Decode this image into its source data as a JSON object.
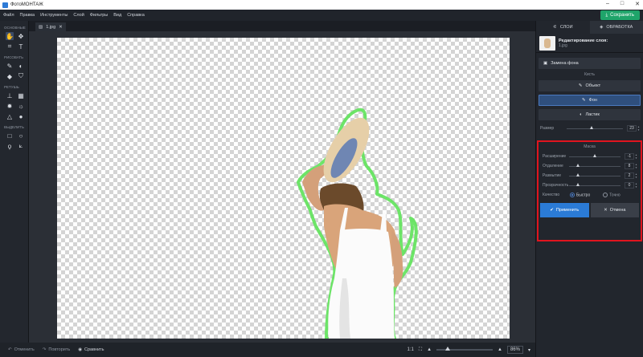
{
  "window": {
    "title": "ФотоМОНТАЖ"
  },
  "menu": [
    "Файл",
    "Правка",
    "Инструменты",
    "Слой",
    "Фильтры",
    "Вид",
    "Справка"
  ],
  "save_button": "Сохранить",
  "tools": {
    "groups": [
      {
        "title": "ОСНОВНЫЕ",
        "rows": [
          [
            "hand-tool-icon",
            "move-tool-icon"
          ],
          [
            "crop-tool-icon",
            "text-tool-icon"
          ]
        ]
      },
      {
        "title": "РИСОВАТЬ",
        "rows": [
          [
            "brush-tool-icon",
            "eraser-tool-icon"
          ],
          [
            "fill-tool-icon",
            "stamp-tool-icon"
          ]
        ]
      },
      {
        "title": "РЕТУШЬ",
        "rows": [
          [
            "clone-tool-icon",
            "pattern-tool-icon"
          ],
          [
            "dodge-tool-icon",
            "burn-tool-icon"
          ],
          [
            "sharpen-tool-icon",
            "drop-tool-icon"
          ]
        ]
      },
      {
        "title": "ВЫДЕЛИТЬ",
        "rows": [
          [
            "rect-select-icon",
            "ellipse-select-icon"
          ],
          [
            "lasso-icon",
            "poly-lasso-icon"
          ]
        ]
      }
    ]
  },
  "file_tab": {
    "name": "1.jpg"
  },
  "bottom": {
    "undo": "Отменить",
    "redo": "Повторить",
    "compare": "Сравнить",
    "ratio": "1:1",
    "zoom": "86%",
    "zoom_level": 0.2
  },
  "panel": {
    "tabs": [
      "СЛОИ",
      "ОБРАБОТКА"
    ],
    "layer_title": "Редактирование слоя:",
    "layer_file": "1.jpg",
    "replace_bg": "Замена фона",
    "brush_section": "Кисть",
    "brush_object": "Объект",
    "brush_bg": "Фон",
    "brush_eraser": "Ластик",
    "size_label": "Размер",
    "size_value": "23",
    "size_level": 0.45,
    "mask_title": "Маска",
    "sliders": [
      {
        "label": "Расширение",
        "value": "-1",
        "level": 0.5
      },
      {
        "label": "Отдаление",
        "value": "8",
        "level": 0.18
      },
      {
        "label": "Размытие",
        "value": "2",
        "level": 0.18
      },
      {
        "label": "Прозрачность",
        "value": "0",
        "level": 0.18
      }
    ],
    "quality_label": "Качество",
    "quality_fast": "Быстро",
    "quality_precise": "Точно",
    "apply": "Применить",
    "cancel": "Отмена"
  },
  "colors": {
    "accent": "#2b7bd6",
    "save": "#1fa46a",
    "highlight_border": "#e0141e",
    "mask_outline": "#5fe35a"
  }
}
